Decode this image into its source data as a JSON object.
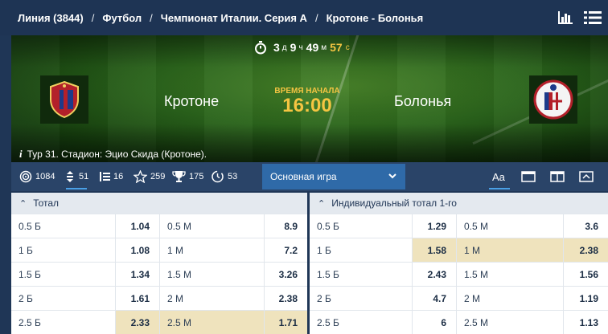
{
  "breadcrumb": {
    "items": [
      "Линия (3844)",
      "Футбол",
      "Чемпионат Италии. Серия А",
      "Кротоне - Болонья"
    ],
    "separator": "/"
  },
  "header_icons": [
    "stats-icon",
    "menu-grid-icon"
  ],
  "match": {
    "timer": {
      "days": "3",
      "days_unit": "д",
      "hours": "9",
      "hours_unit": "ч",
      "minutes": "49",
      "minutes_unit": "м",
      "seconds": "57",
      "seconds_unit": "с"
    },
    "home_team": "Кротоне",
    "away_team": "Болонья",
    "start_label": "ВРЕМЯ НАЧАЛА",
    "start_time": "16:00",
    "info": "Тур 31. Стадион: Эцио Скида (Кротоне).",
    "info_icon": "info-icon"
  },
  "tabs": [
    {
      "icon": "target-icon",
      "count": "1084"
    },
    {
      "icon": "sort-icon",
      "count": "51"
    },
    {
      "icon": "list-icon",
      "count": "16"
    },
    {
      "icon": "star-icon",
      "count": "259"
    },
    {
      "icon": "trophy-icon",
      "count": "175"
    },
    {
      "icon": "clock-icon",
      "count": "53"
    }
  ],
  "selector": {
    "value": "Основная игра"
  },
  "view_buttons": [
    "font-size-icon",
    "single-column-icon",
    "two-column-icon",
    "collapse-icon"
  ],
  "markets": {
    "left": {
      "title": "Тотал",
      "rows": [
        {
          "l1": "0.5 Б",
          "o1": "1.04",
          "l2": "0.5 М",
          "o2": "8.9"
        },
        {
          "l1": "1 Б",
          "o1": "1.08",
          "l2": "1 М",
          "o2": "7.2"
        },
        {
          "l1": "1.5 Б",
          "o1": "1.34",
          "l2": "1.5 М",
          "o2": "3.26"
        },
        {
          "l1": "2 Б",
          "o1": "1.61",
          "l2": "2 М",
          "o2": "2.38"
        },
        {
          "l1": "2.5 Б",
          "o1": "2.33",
          "l2": "2.5 М",
          "o2": "1.71"
        }
      ]
    },
    "right": {
      "title": "Индивидуальный тотал 1-го",
      "rows": [
        {
          "l1": "0.5 Б",
          "o1": "1.29",
          "l2": "0.5 М",
          "o2": "3.6"
        },
        {
          "l1": "1 Б",
          "o1": "1.58",
          "l2": "1 М",
          "o2": "2.38"
        },
        {
          "l1": "1.5 Б",
          "o1": "2.43",
          "l2": "1.5 М",
          "o2": "1.56"
        },
        {
          "l1": "2 Б",
          "o1": "4.7",
          "l2": "2 М",
          "o2": "1.19"
        },
        {
          "l1": "2.5 Б",
          "o1": "6",
          "l2": "2.5 М",
          "o2": "1.13"
        }
      ]
    }
  },
  "colors": {
    "highlight": "#efe3bd",
    "accent_yellow": "#f5c542",
    "header_bg": "#1e3454"
  }
}
